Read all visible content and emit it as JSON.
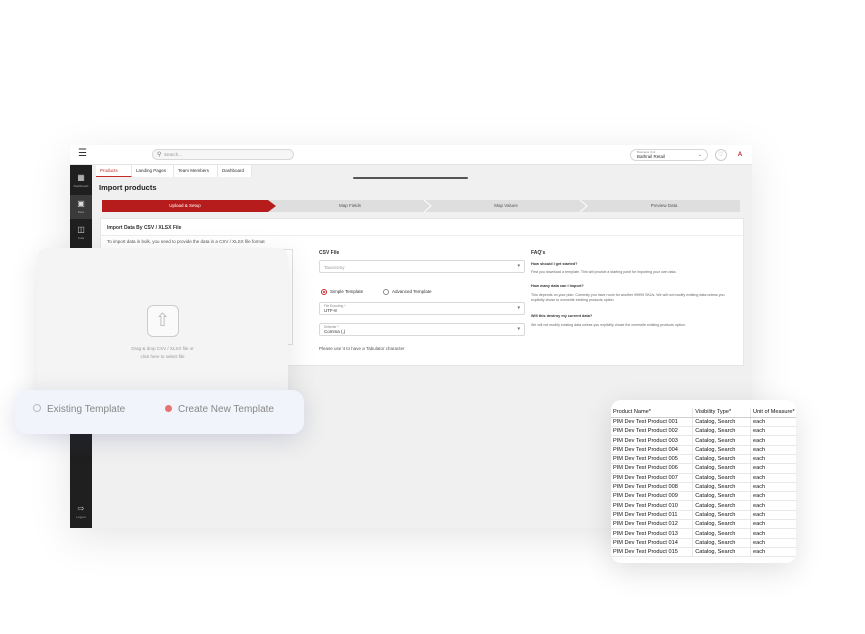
{
  "topbar": {
    "search_placeholder": "Search...",
    "store_label": "Business Unit",
    "store_value": "Bathrail Retail",
    "user_initial": "A"
  },
  "sidebar": {
    "items": [
      {
        "label": "Dashboard",
        "icon": "dashboard-icon"
      },
      {
        "label": "Files",
        "icon": "file-icon"
      },
      {
        "label": "Cats",
        "icon": "catalog-icon"
      }
    ],
    "logout_label": "Logout"
  },
  "tabs": [
    {
      "label": "Products"
    },
    {
      "label": "Landing Pages"
    },
    {
      "label": "Team Members"
    },
    {
      "label": "Dashboard"
    }
  ],
  "page_title": "Import products",
  "steps": [
    {
      "label": "Upload & Setup"
    },
    {
      "label": "Map Fields"
    },
    {
      "label": "Map Values"
    },
    {
      "label": "Preview Data"
    }
  ],
  "import_card": {
    "title": "Import Data By CSV / XLSX File",
    "description": "To import data in bulk, you need to provide the data in a CSV / XLSX file format",
    "csv_title": "CSV File",
    "taxonomy_placeholder": "Taxonomy",
    "template_simple": "Simple Template",
    "template_advanced": "Advanced Template",
    "encoding_label": "File Encoding *",
    "encoding_value": "UTF-8",
    "delimiter_label": "Delimiter *",
    "delimiter_value": "Comma (,)",
    "hint": "Please use \\t to have a Tabulator character"
  },
  "faq": {
    "title": "FAQ's",
    "items": [
      {
        "q": "How should I get started?",
        "a": "First you download a template. This will provide a starting point for importing your own data."
      },
      {
        "q": "How many data can I import?",
        "a": "This depends on your plan. Currently you have room for another 99999 SKUs. We will not modify existing data unless you explicitly chose to overwrite existing products option."
      },
      {
        "q": "Will this destroy my current data?",
        "a": "We will not modify existing data unless you explicitly chose the overwrite existing products option."
      }
    ]
  },
  "upload": {
    "text_line1": "Drag & drop CSV / XLSX file or",
    "text_line2": "click here to select file"
  },
  "template_selector": {
    "existing": "Existing Template",
    "create_new": "Create New Template"
  },
  "sheet": {
    "headers": [
      "Product Name*",
      "Visibility Type*",
      "Unit of Measure*"
    ],
    "rows": [
      [
        "PIM Dev Test Product 001",
        "Catalog, Search",
        "each"
      ],
      [
        "PIM Dev Test Product 002",
        "Catalog, Search",
        "each"
      ],
      [
        "PIM Dev Test Product 003",
        "Catalog, Search",
        "each"
      ],
      [
        "PIM Dev Test Product 004",
        "Catalog, Search",
        "each"
      ],
      [
        "PIM Dev Test Product 005",
        "Catalog, Search",
        "each"
      ],
      [
        "PIM Dev Test Product 006",
        "Catalog, Search",
        "each"
      ],
      [
        "PIM Dev Test Product 007",
        "Catalog, Search",
        "each"
      ],
      [
        "PIM Dev Test Product 008",
        "Catalog, Search",
        "each"
      ],
      [
        "PIM Dev Test Product 009",
        "Catalog, Search",
        "each"
      ],
      [
        "PIM Dev Test Product 010",
        "Catalog, Search",
        "each"
      ],
      [
        "PIM Dev Test Product 011",
        "Catalog, Search",
        "each"
      ],
      [
        "PIM Dev Test Product 012",
        "Catalog, Search",
        "each"
      ],
      [
        "PIM Dev Test Product 013",
        "Catalog, Search",
        "each"
      ],
      [
        "PIM Dev Test Product 014",
        "Catalog, Search",
        "each"
      ],
      [
        "PIM Dev Test Product 015",
        "Catalog, Search",
        "each"
      ]
    ]
  },
  "colors": {
    "accent": "#b71c1c",
    "sidebar": "#1f1f1f",
    "radio_selected": "#e57373"
  }
}
